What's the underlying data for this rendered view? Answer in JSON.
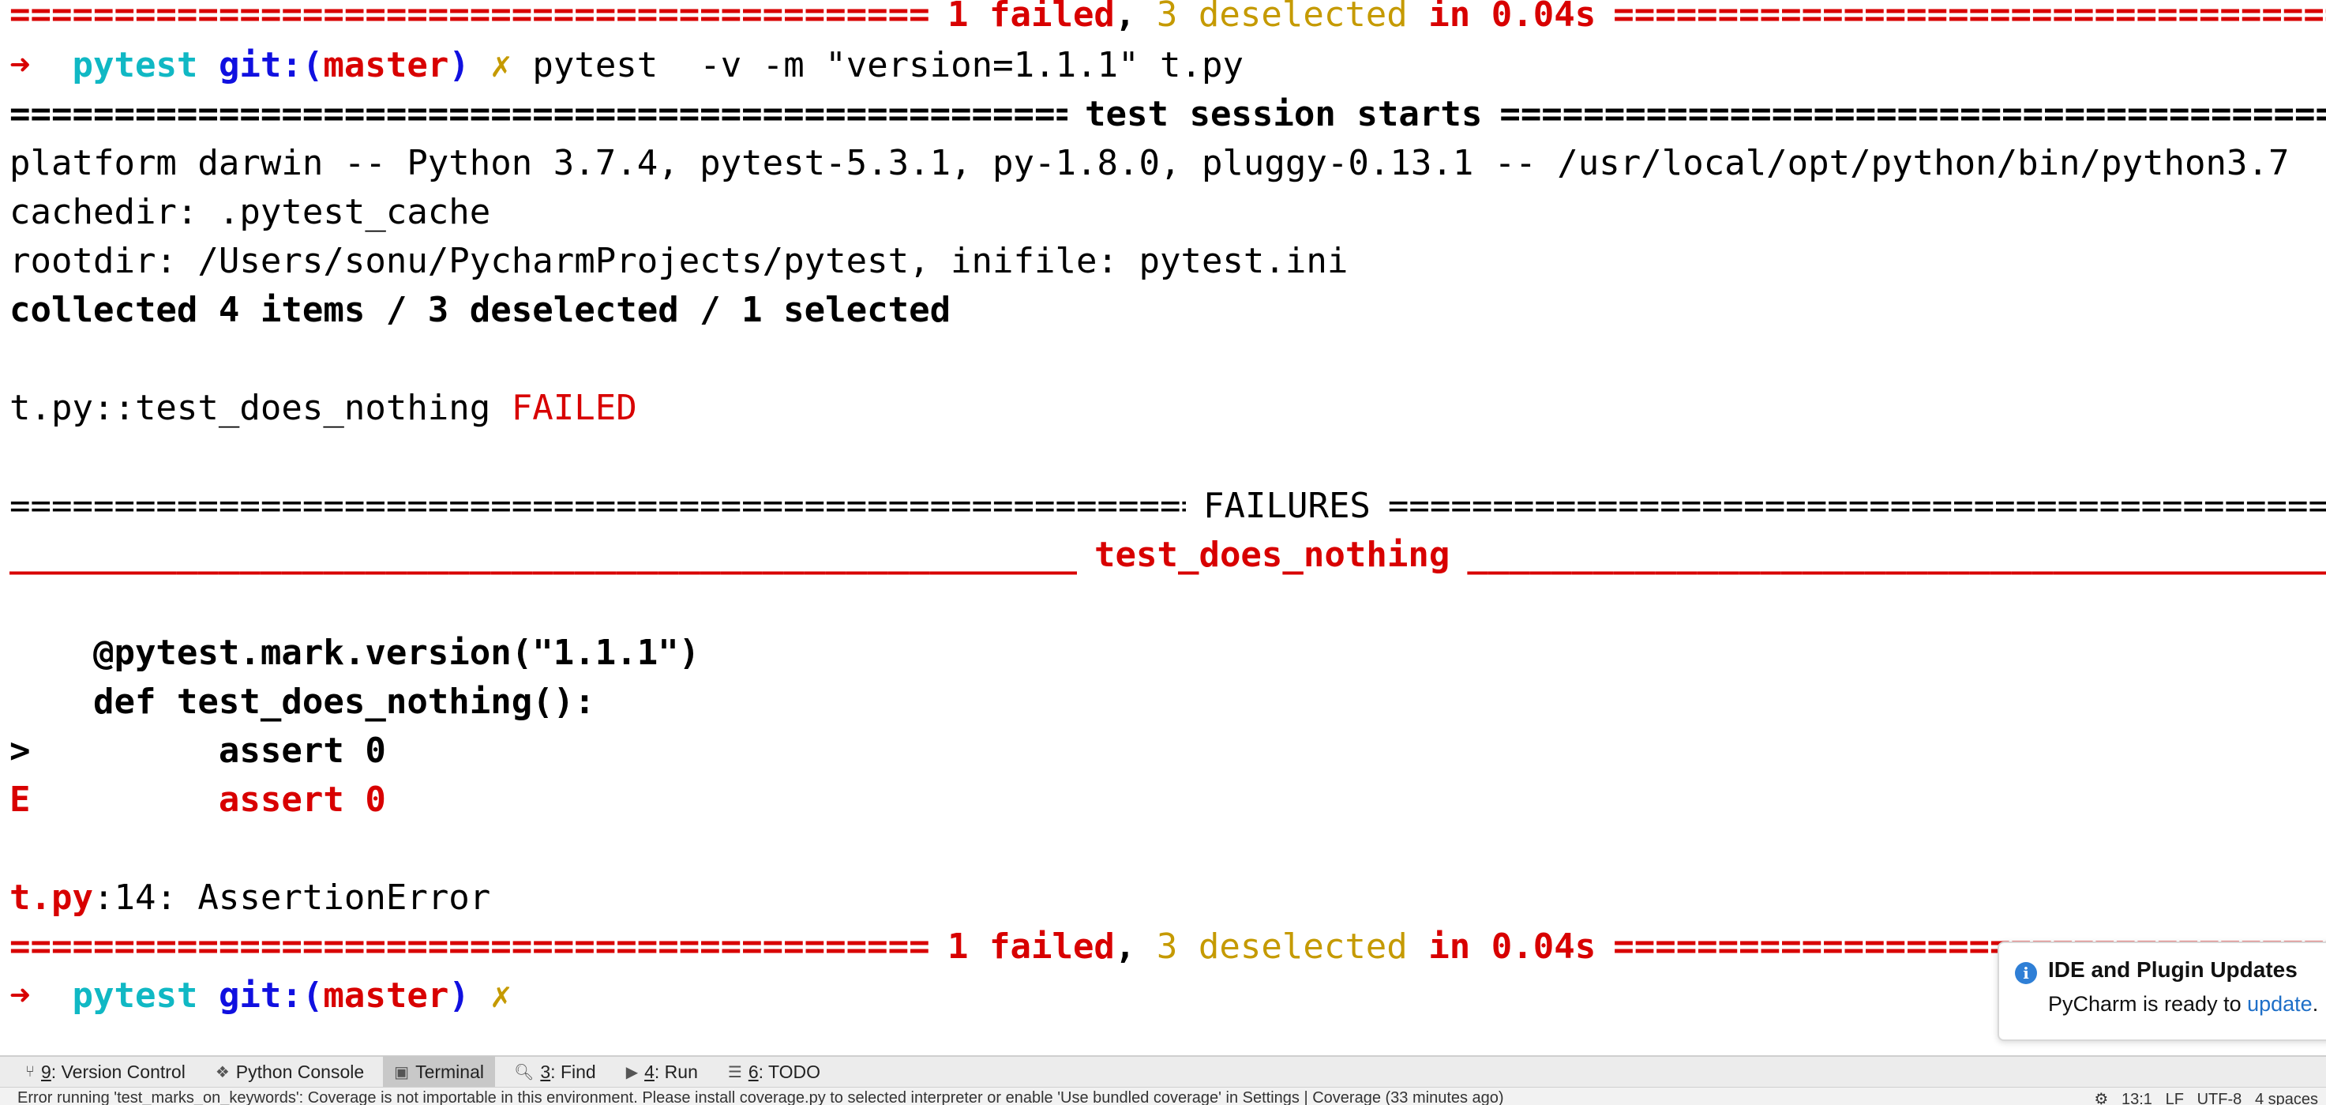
{
  "terminal": {
    "fill_equals": "==========================================================================================================================================",
    "fill_underscore": "__________________________________________________________________________________________________________________________________________",
    "summary_top": {
      "failed": "1 failed",
      "sep": ", ",
      "deselected": "3 deselected",
      "time": " in 0.04s"
    },
    "prompt1": {
      "arrow": "➜",
      "dir": "pytest",
      "git": "git:(",
      "branch": "master",
      "git_close": ")",
      "dirty": "✗",
      "command": "pytest  -v -m \"version=1.1.1\" t.py"
    },
    "session_banner": "test session starts",
    "platform": "platform darwin -- Python 3.7.4, pytest-5.3.1, py-1.8.0, pluggy-0.13.1 -- /usr/local/opt/python/bin/python3.7",
    "cachedir": "cachedir: .pytest_cache",
    "rootdir": "rootdir: /Users/sonu/PycharmProjects/pytest, inifile: pytest.ini",
    "collected": "collected 4 items / 3 deselected / 1 selected",
    "result": {
      "test": "t.py::test_does_nothing ",
      "status": "FAILED"
    },
    "failures_banner": "FAILURES",
    "test_banner": "test_does_nothing",
    "code": {
      "decorator": "    @pytest.mark.version(\"1.1.1\")",
      "def": "    def test_does_nothing():",
      "gt_marker": ">",
      "assert1": "         assert 0",
      "e_marker": "E",
      "assert2": "         assert 0"
    },
    "error": {
      "file": "t.py",
      "rest": ":14: AssertionError"
    },
    "summary_bottom": {
      "failed": "1 failed",
      "sep": ", ",
      "deselected": "3 deselected",
      "time": " in 0.04s"
    },
    "prompt2": {
      "arrow": "➜",
      "dir": "pytest",
      "git": "git:(",
      "branch": "master",
      "git_close": ")",
      "dirty": "✗"
    }
  },
  "notification": {
    "title": "IDE and Plugin Updates",
    "body_prefix": "PyCharm is ready to ",
    "link": "update",
    "body_suffix": "."
  },
  "toolwindows": [
    {
      "num": "9",
      "label": ": Version Control",
      "icon": "version-control-icon"
    },
    {
      "num": "",
      "label": "Python Console",
      "icon": "python-console-icon"
    },
    {
      "num": "",
      "label": "Terminal",
      "icon": "terminal-icon",
      "active": true
    },
    {
      "num": "3",
      "label": ": Find",
      "icon": "search-icon"
    },
    {
      "num": "4",
      "label": ": Run",
      "icon": "run-icon"
    },
    {
      "num": "6",
      "label": ": TODO",
      "icon": "todo-icon"
    }
  ],
  "statusbar": {
    "message": "Error running 'test_marks_on_keywords': Coverage is not importable in this environment. Please install coverage.py to selected interpreter or enable 'Use bundled coverage' in Settings | Coverage (33 minutes ago)",
    "position": "13:1",
    "line_sep": "LF",
    "encoding": "UTF-8",
    "indent": "4 spaces"
  },
  "colors": {
    "red": "#d80000",
    "yellow": "#c59a00",
    "cyan": "#10b8c4",
    "blue": "#1010e0",
    "link": "#1e6fc8"
  }
}
